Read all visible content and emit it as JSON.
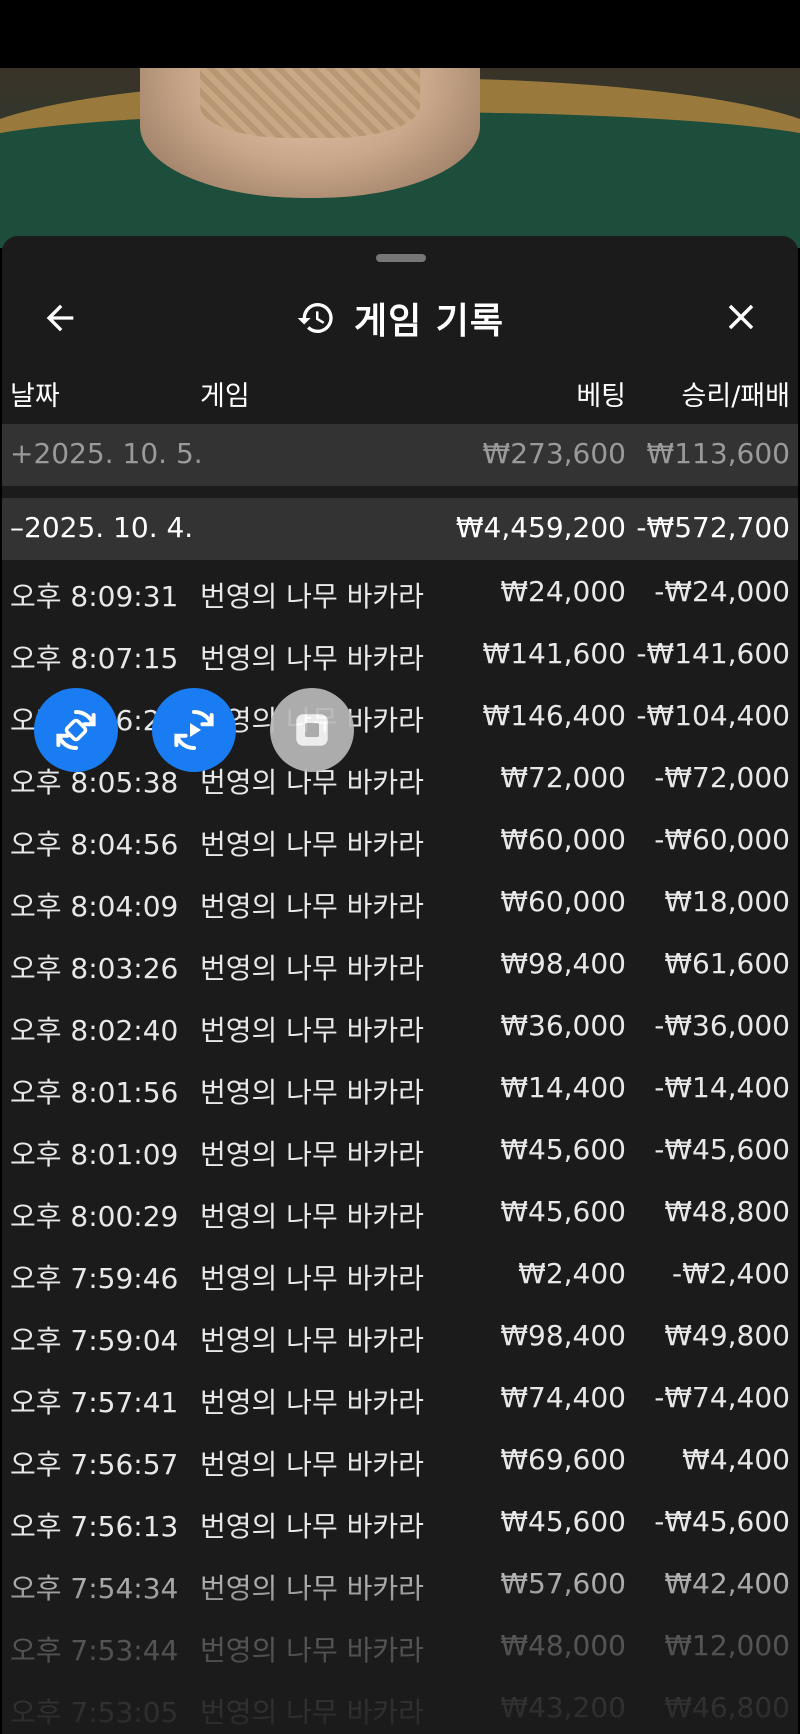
{
  "header": {
    "title": "게임 기록"
  },
  "columns": {
    "date": "날짜",
    "game": "게임",
    "bet": "베팅",
    "result": "승리/패배"
  },
  "groups": [
    {
      "toggle": "+",
      "date": "2025. 10. 5.",
      "bet": "₩273,600",
      "result": "₩113,600",
      "expanded": false
    },
    {
      "toggle": "–",
      "date": "2025. 10. 4.",
      "bet": "₩4,459,200",
      "result": "-₩572,700",
      "expanded": true
    }
  ],
  "rows": [
    {
      "time": "오후 8:09:31",
      "game": "번영의 나무 바카라",
      "bet": "₩24,000",
      "result": "-₩24,000"
    },
    {
      "time": "오후 8:07:15",
      "game": "번영의 나무 바카라",
      "bet": "₩141,600",
      "result": "-₩141,600"
    },
    {
      "time": "오후 8:06:2",
      "game": "번영의 나무 바카라",
      "bet": "₩146,400",
      "result": "-₩104,400"
    },
    {
      "time": "오후 8:05:38",
      "game": "번영의 나무 바카라",
      "bet": "₩72,000",
      "result": "-₩72,000"
    },
    {
      "time": "오후 8:04:56",
      "game": "번영의 나무 바카라",
      "bet": "₩60,000",
      "result": "-₩60,000"
    },
    {
      "time": "오후 8:04:09",
      "game": "번영의 나무 바카라",
      "bet": "₩60,000",
      "result": "₩18,000"
    },
    {
      "time": "오후 8:03:26",
      "game": "번영의 나무 바카라",
      "bet": "₩98,400",
      "result": "₩61,600"
    },
    {
      "time": "오후 8:02:40",
      "game": "번영의 나무 바카라",
      "bet": "₩36,000",
      "result": "-₩36,000"
    },
    {
      "time": "오후 8:01:56",
      "game": "번영의 나무 바카라",
      "bet": "₩14,400",
      "result": "-₩14,400"
    },
    {
      "time": "오후 8:01:09",
      "game": "번영의 나무 바카라",
      "bet": "₩45,600",
      "result": "-₩45,600"
    },
    {
      "time": "오후 8:00:29",
      "game": "번영의 나무 바카라",
      "bet": "₩45,600",
      "result": "₩48,800"
    },
    {
      "time": "오후 7:59:46",
      "game": "번영의 나무 바카라",
      "bet": "₩2,400",
      "result": "-₩2,400"
    },
    {
      "time": "오후 7:59:04",
      "game": "번영의 나무 바카라",
      "bet": "₩98,400",
      "result": "₩49,800"
    },
    {
      "time": "오후 7:57:41",
      "game": "번영의 나무 바카라",
      "bet": "₩74,400",
      "result": "-₩74,400"
    },
    {
      "time": "오후 7:56:57",
      "game": "번영의 나무 바카라",
      "bet": "₩69,600",
      "result": "₩4,400"
    },
    {
      "time": "오후 7:56:13",
      "game": "번영의 나무 바카라",
      "bet": "₩45,600",
      "result": "-₩45,600"
    },
    {
      "time": "오후 7:54:34",
      "game": "번영의 나무 바카라",
      "bet": "₩57,600",
      "result": "₩42,400"
    },
    {
      "time": "오후 7:53:44",
      "game": "번영의 나무 바카라",
      "bet": "₩48,000",
      "result": "₩12,000"
    },
    {
      "time": "오후 7:53:05",
      "game": "번영의 나무 바카라",
      "bet": "₩43,200",
      "result": "₩46,800"
    }
  ],
  "floating_controls": [
    {
      "icon": "auto-rotate-icon"
    },
    {
      "icon": "replay-icon"
    },
    {
      "icon": "stop-icon"
    }
  ],
  "colors": {
    "sheet_bg": "#1b1b1b",
    "group_bg": "#333333",
    "fab_blue": "#1a7cf2",
    "fab_grey": "#b9b9b9"
  }
}
